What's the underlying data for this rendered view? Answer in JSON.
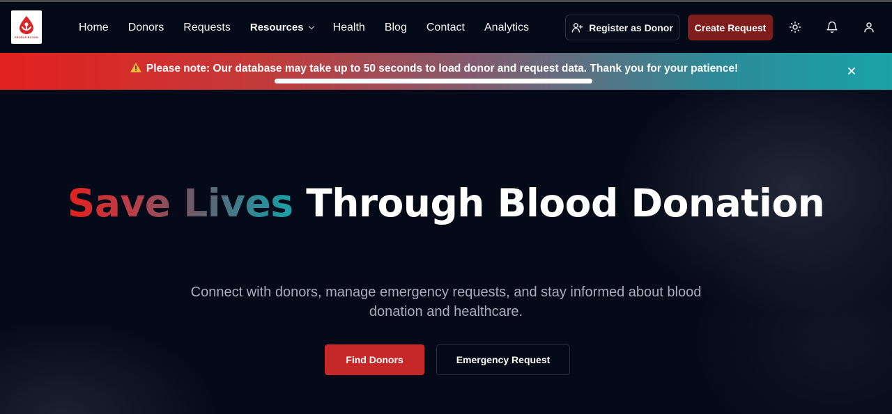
{
  "header": {
    "logo_text": "PEOPLE BLOOD",
    "nav": {
      "home": "Home",
      "donors": "Donors",
      "requests": "Requests",
      "resources": "Resources",
      "health": "Health",
      "blog": "Blog",
      "contact": "Contact",
      "analytics": "Analytics"
    },
    "register_label": "Register as Donor",
    "create_label": "Create Request",
    "icons": [
      "user-plus-icon",
      "sun-icon",
      "bell-icon",
      "user-icon",
      "chevron-down-icon"
    ]
  },
  "banner": {
    "message": "Please note: Our database may take up to 50 seconds to load donor and request data. Thank you for your patience!",
    "progress_percent": 100,
    "icons": [
      "warning-icon",
      "close-icon"
    ]
  },
  "hero": {
    "title_highlight": "Save Lives",
    "title_rest": "Through Blood Donation",
    "subtitle": "Connect with donors, manage emergency requests, and stay informed about blood donation and healthcare.",
    "find_donors_label": "Find Donors",
    "emergency_label": "Emergency Request"
  },
  "colors": {
    "background": "#050a18",
    "brand_red": "#c62828",
    "create_button": "#7f1d1d",
    "banner_start": "#e3211e",
    "banner_end": "#18a3a7"
  }
}
